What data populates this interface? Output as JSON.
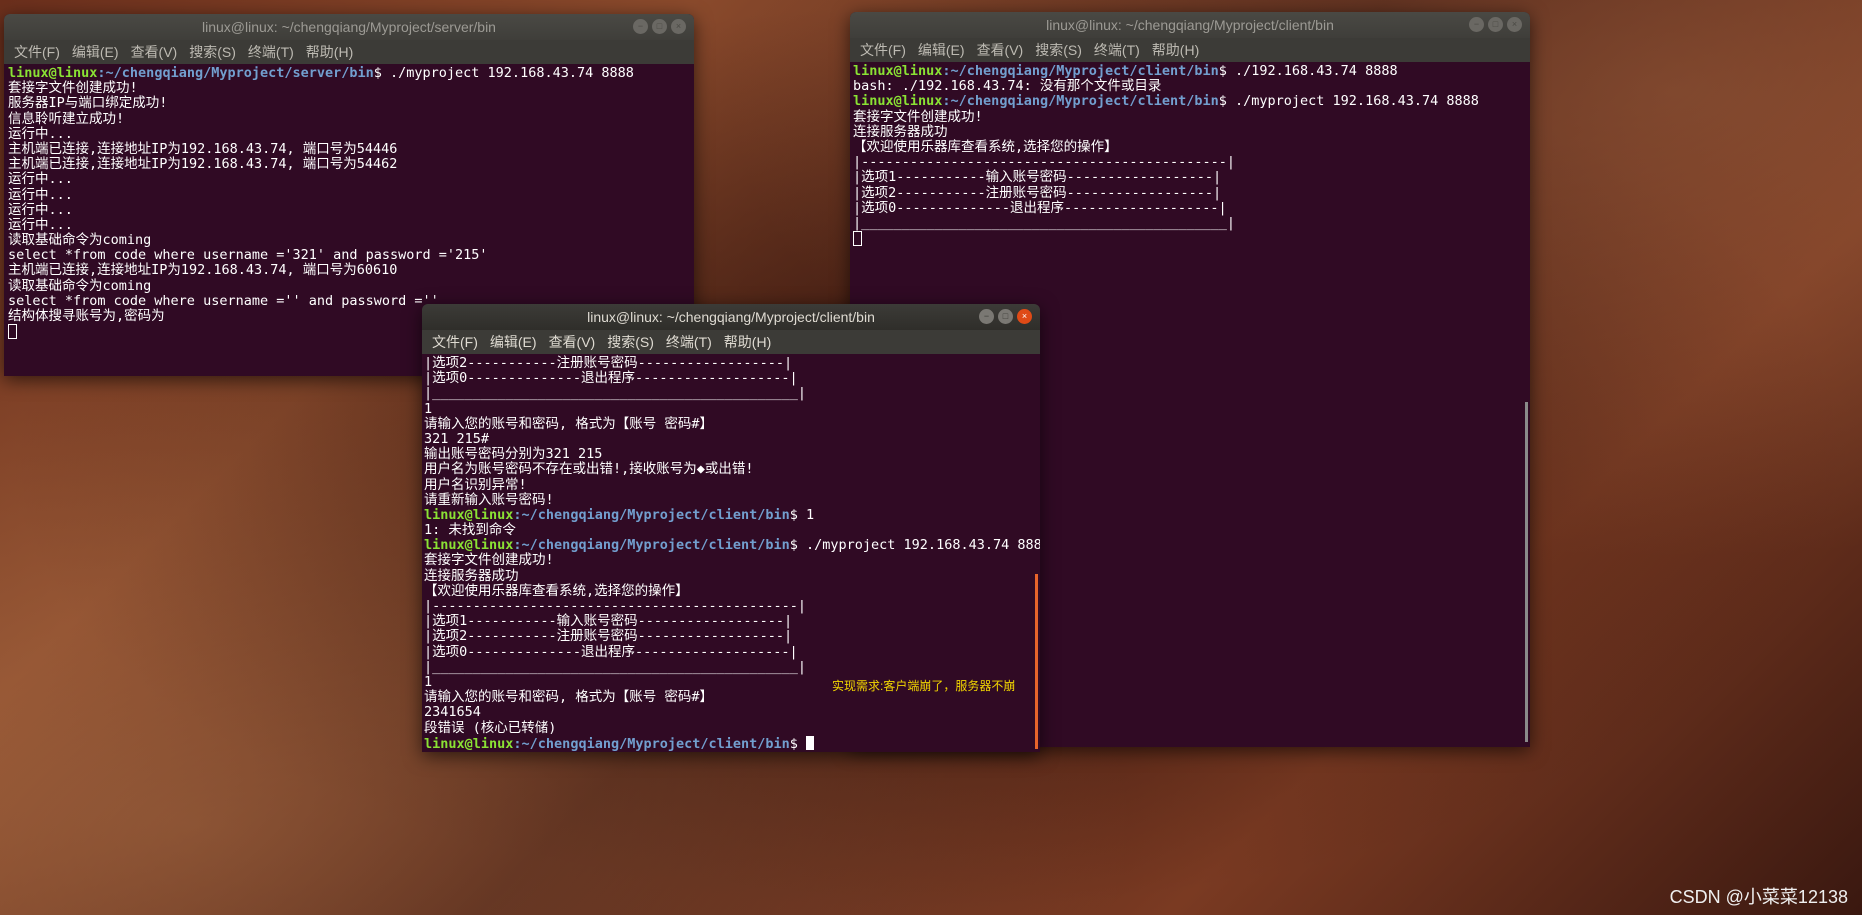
{
  "server": {
    "title": "linux@linux: ~/chengqiang/Myproject/server/bin",
    "menu": [
      "文件(F)",
      "编辑(E)",
      "查看(V)",
      "搜索(S)",
      "终端(T)",
      "帮助(H)"
    ],
    "lines": [
      {
        "user": "linux@linux",
        "path": "~/chengqiang/Myproject/server/bin",
        "cmd": "$ ./myproject 192.168.43.74 8888"
      },
      {
        "text": "套接字文件创建成功!"
      },
      {
        "text": "服务器IP与端口绑定成功!"
      },
      {
        "text": "信息聆听建立成功!"
      },
      {
        "text": "运行中..."
      },
      {
        "text": "主机端已连接,连接地址IP为192.168.43.74, 端口号为54446"
      },
      {
        "text": "主机端已连接,连接地址IP为192.168.43.74, 端口号为54462"
      },
      {
        "text": "运行中..."
      },
      {
        "text": "运行中..."
      },
      {
        "text": "运行中..."
      },
      {
        "text": "运行中..."
      },
      {
        "text": "读取基础命令为coming"
      },
      {
        "text": "select *from code where username ='321' and password ='215'"
      },
      {
        "text": "主机端已连接,连接地址IP为192.168.43.74, 端口号为60610"
      },
      {
        "text": "读取基础命令为coming"
      },
      {
        "text": "select *from code where username ='' and password =''"
      },
      {
        "text": "结构体搜寻账号为,密码为"
      }
    ]
  },
  "client1": {
    "title": "linux@linux: ~/chengqiang/Myproject/client/bin",
    "menu": [
      "文件(F)",
      "编辑(E)",
      "查看(V)",
      "搜索(S)",
      "终端(T)",
      "帮助(H)"
    ],
    "lines": [
      {
        "user": "linux@linux",
        "path": "~/chengqiang/Myproject/client/bin",
        "cmd": "$ ./192.168.43.74 8888"
      },
      {
        "text": "bash: ./192.168.43.74: 没有那个文件或目录"
      },
      {
        "user": "linux@linux",
        "path": "~/chengqiang/Myproject/client/bin",
        "cmd": "$ ./myproject 192.168.43.74 8888"
      },
      {
        "text": "套接字文件创建成功!"
      },
      {
        "text": "连接服务器成功"
      },
      {
        "text": "【欢迎使用乐器库查看系统,选择您的操作】"
      },
      {
        "text": "|---------------------------------------------|"
      },
      {
        "text": "|选项1-----------输入账号密码------------------|"
      },
      {
        "text": "|选项2-----------注册账号密码------------------|"
      },
      {
        "text": "|选项0--------------退出程序-------------------|"
      },
      {
        "text": "|_____________________________________________|"
      }
    ]
  },
  "client2": {
    "title": "linux@linux: ~/chengqiang/Myproject/client/bin",
    "menu": [
      "文件(F)",
      "编辑(E)",
      "查看(V)",
      "搜索(S)",
      "终端(T)",
      "帮助(H)"
    ],
    "lines": [
      {
        "text": "|选项2-----------注册账号密码------------------|"
      },
      {
        "text": "|选项0--------------退出程序-------------------|"
      },
      {
        "text": "|_____________________________________________|"
      },
      {
        "text": "1"
      },
      {
        "text": "请输入您的账号和密码, 格式为【账号 密码#】"
      },
      {
        "text": "321 215#"
      },
      {
        "text": "输出账号密码分别为321 215"
      },
      {
        "text": "用户名为账号密码不存在或出错!,接收账号为◆或出错!"
      },
      {
        "text": "用户名识别异常!"
      },
      {
        "text": "请重新输入账号密码!"
      },
      {
        "user": "linux@linux",
        "path": "~/chengqiang/Myproject/client/bin",
        "cmd": "$ 1"
      },
      {
        "text": "1: 未找到命令"
      },
      {
        "user": "linux@linux",
        "path": "~/chengqiang/Myproject/client/bin",
        "cmd": "$ ./myproject 192.168.43.74 8888"
      },
      {
        "text": "套接字文件创建成功!"
      },
      {
        "text": "连接服务器成功"
      },
      {
        "text": "【欢迎使用乐器库查看系统,选择您的操作】"
      },
      {
        "text": "|---------------------------------------------|"
      },
      {
        "text": "|选项1-----------输入账号密码------------------|"
      },
      {
        "text": "|选项2-----------注册账号密码------------------|"
      },
      {
        "text": "|选项0--------------退出程序-------------------|"
      },
      {
        "text": "|_____________________________________________|"
      },
      {
        "text": "1"
      },
      {
        "text": "请输入您的账号和密码, 格式为【账号 密码#】"
      },
      {
        "text": "2341654"
      },
      {
        "text": "段错误 (核心已转储)"
      },
      {
        "user": "linux@linux",
        "path": "~/chengqiang/Myproject/client/bin",
        "cmd": "$ "
      }
    ],
    "annotation": "实现需求:客户端崩了，服务器不崩"
  },
  "watermark": "CSDN @小菜菜12138",
  "colors": {
    "terminal_bg": "#300a24",
    "prompt_user": "#8ae234",
    "prompt_path": "#729fcf",
    "close_button": "#df4a16",
    "annotation": "#f2d600"
  }
}
